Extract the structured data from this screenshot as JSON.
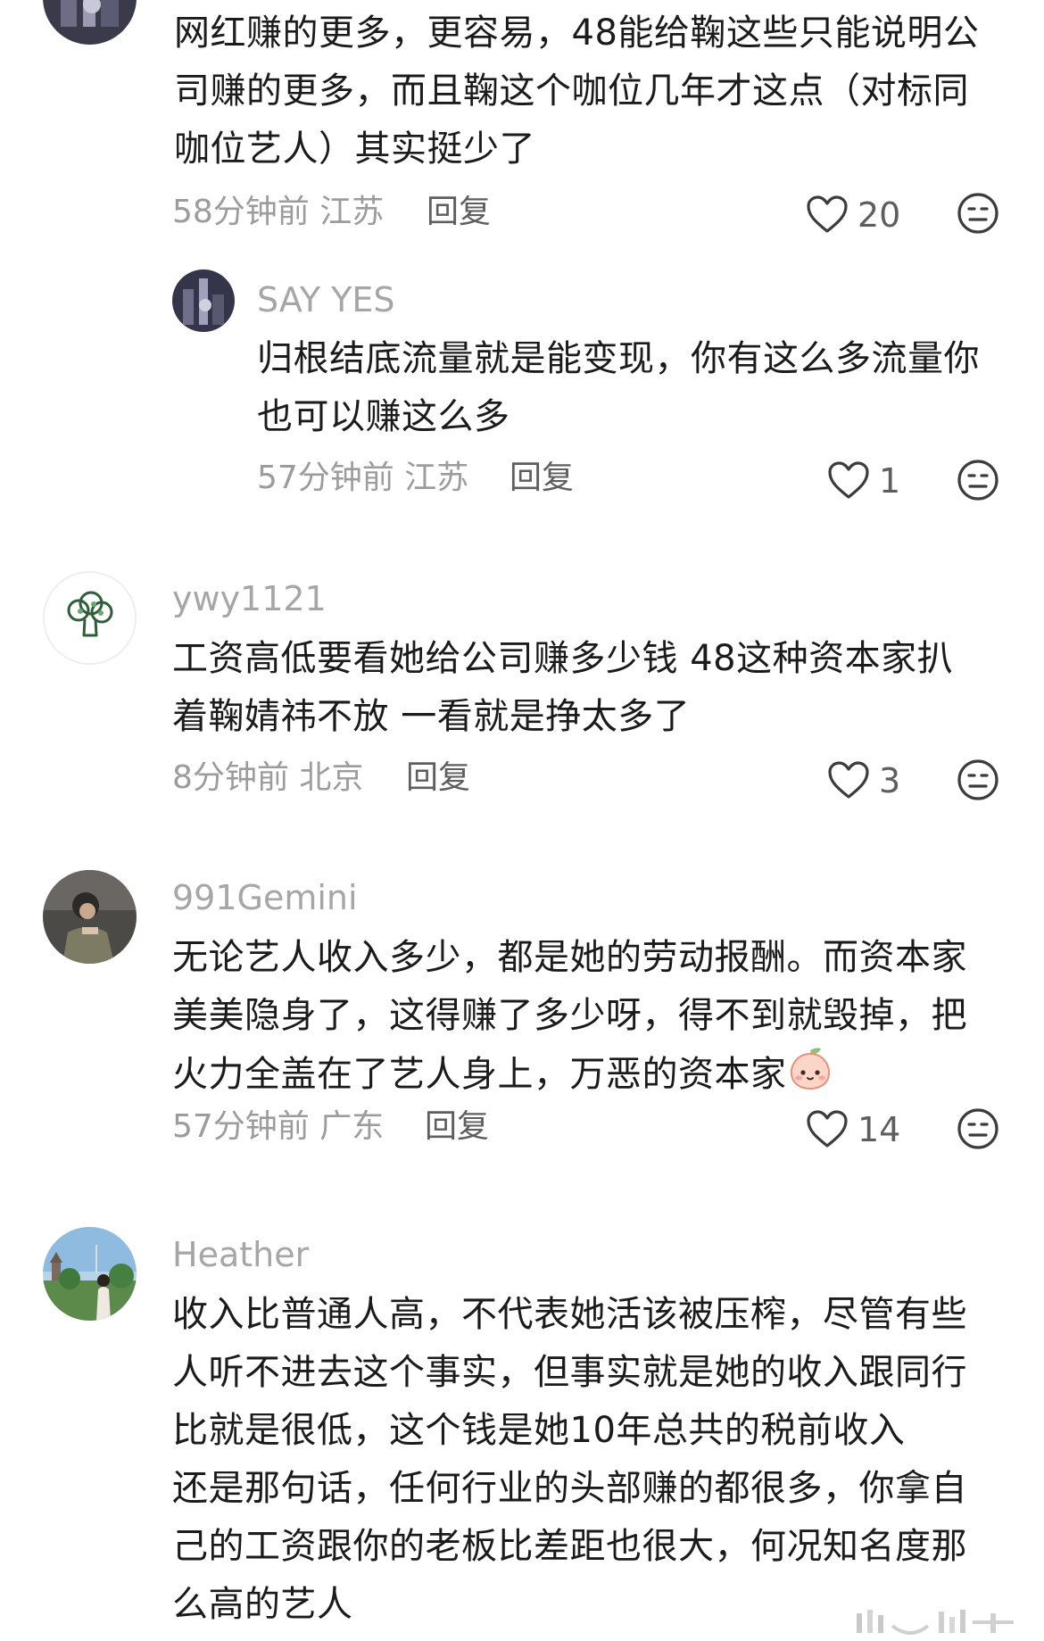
{
  "comments": [
    {
      "username": "",
      "content": "网红赚的更多，更容易，48能给鞠这些只能说明公\n司赚的更多，而且鞠这个咖位几年才这点（对标同\n咖位艺人）其实挺少了",
      "meta": "58分钟前 江苏",
      "reply_label": "回复",
      "like_count": "20",
      "avatar": "dark-city-icon"
    },
    {
      "username": "SAY YES",
      "content": "归根结底流量就是能变现，你有这么多流量你\n也可以赚这么多",
      "meta": "57分钟前 江苏",
      "reply_label": "回复",
      "like_count": "1",
      "avatar": "dark-city-icon"
    },
    {
      "username": "ywy1121",
      "content": "工资高低要看她给公司赚多少钱 48这种资本家扒\n着鞠婧祎不放 一看就是挣太多了",
      "meta": "8分钟前 北京",
      "reply_label": "回复",
      "like_count": "3",
      "avatar": "broccoli-icon"
    },
    {
      "username": "991Gemini",
      "content": "无论艺人收入多少，都是她的劳动报酬。而资本家\n美美隐身了，这得赚了多少呀，得不到就毁掉，把\n火力全盖在了艺人身上，万恶的资本家",
      "meta": "57分钟前 广东",
      "reply_label": "回复",
      "like_count": "14",
      "avatar": "person-photo-icon",
      "sticker": "peach-emoji-icon"
    },
    {
      "username": "Heather",
      "content": "收入比普通人高，不代表她活该被压榨，尽管有些\n人听不进去这个事实，但事实就是她的收入跟同行\n比就是很低，这个钱是她10年总共的税前收入\n还是那句话，任何行业的头部赚的都很多，你拿自\n己的工资跟你的老板比差距也很大，何况知名度那\n么高的艺人",
      "avatar": "landscape-photo-icon"
    }
  ],
  "icons": {
    "like": "heart-outline-icon",
    "dislike": "neutral-face-icon"
  },
  "colors": {
    "text": "#1b1b1b",
    "username": "#a6a6a6",
    "meta": "#9c9c9c",
    "action": "#5e5e5e"
  }
}
